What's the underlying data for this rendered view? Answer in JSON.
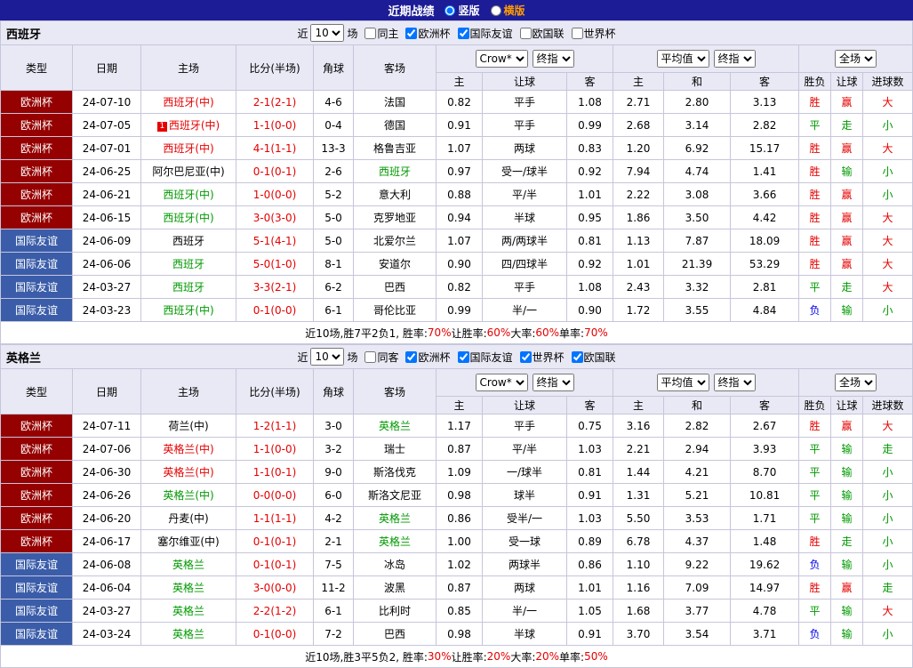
{
  "colors": {
    "topbar_bg": "#1c1c96",
    "header_bg": "#e9e9f5",
    "euro_bg": "#950000",
    "friendly_bg": "#3b5da9",
    "red": "#e60000",
    "green": "#009900",
    "blue": "#0000ee",
    "border": "#c6c6dc",
    "orange": "#ff9c00"
  },
  "topbar": {
    "title": "近期战绩",
    "options": [
      {
        "label": "竖版",
        "selected": true
      },
      {
        "label": "横版",
        "selected": false
      }
    ]
  },
  "columns": {
    "type": "类型",
    "date": "日期",
    "home": "主场",
    "score": "比分(半场)",
    "corner": "角球",
    "away": "客场",
    "sub": [
      "主",
      "让球",
      "客",
      "主",
      "和",
      "客",
      "胜负",
      "让球",
      "进球数"
    ],
    "selects": {
      "book": "Crow*",
      "final1": "终指",
      "avg": "平均值",
      "final2": "终指",
      "scope": "全场"
    }
  },
  "filter_common": {
    "near": "近",
    "games": "场"
  },
  "sections": [
    {
      "team": "西班牙",
      "filter": {
        "count": "10",
        "checks": [
          {
            "label": "同主",
            "checked": false
          },
          {
            "label": "欧洲杯",
            "checked": true
          },
          {
            "label": "国际友谊",
            "checked": true
          },
          {
            "label": "欧国联",
            "checked": false
          },
          {
            "label": "世界杯",
            "checked": false
          }
        ]
      },
      "rows": [
        {
          "type": "欧洲杯",
          "tstyle": "euro",
          "date": "24-07-10",
          "home": "西班牙(中)",
          "hcolor": "red",
          "badge": "",
          "score": "2-1(2-1)",
          "corner": "4-6",
          "away": "法国",
          "acolor": "black",
          "o_home": "0.82",
          "line": "平手",
          "o_away": "1.08",
          "avg_home": "2.71",
          "avg_draw": "2.80",
          "avg_away": "3.13",
          "result": "胜",
          "result_color": "red",
          "cover": "赢",
          "cover_color": "red",
          "ou": "大",
          "ou_color": "red"
        },
        {
          "type": "欧洲杯",
          "tstyle": "euro",
          "date": "24-07-05",
          "home": "西班牙(中)",
          "hcolor": "red",
          "badge": "1",
          "score": "1-1(0-0)",
          "corner": "0-4",
          "away": "德国",
          "acolor": "black",
          "o_home": "0.91",
          "line": "平手",
          "o_away": "0.99",
          "avg_home": "2.68",
          "avg_draw": "3.14",
          "avg_away": "2.82",
          "result": "平",
          "result_color": "green",
          "cover": "走",
          "cover_color": "green",
          "ou": "小",
          "ou_color": "green"
        },
        {
          "type": "欧洲杯",
          "tstyle": "euro",
          "date": "24-07-01",
          "home": "西班牙(中)",
          "hcolor": "red",
          "badge": "",
          "score": "4-1(1-1)",
          "corner": "13-3",
          "away": "格鲁吉亚",
          "acolor": "black",
          "o_home": "1.07",
          "line": "两球",
          "o_away": "0.83",
          "avg_home": "1.20",
          "avg_draw": "6.92",
          "avg_away": "15.17",
          "result": "胜",
          "result_color": "red",
          "cover": "赢",
          "cover_color": "red",
          "ou": "大",
          "ou_color": "red"
        },
        {
          "type": "欧洲杯",
          "tstyle": "euro",
          "date": "24-06-25",
          "home": "阿尔巴尼亚(中)",
          "hcolor": "black",
          "badge": "",
          "score": "0-1(0-1)",
          "corner": "2-6",
          "away": "西班牙",
          "acolor": "green",
          "o_home": "0.97",
          "line": "受一/球半",
          "o_away": "0.92",
          "avg_home": "7.94",
          "avg_draw": "4.74",
          "avg_away": "1.41",
          "result": "胜",
          "result_color": "red",
          "cover": "输",
          "cover_color": "green",
          "ou": "小",
          "ou_color": "green"
        },
        {
          "type": "欧洲杯",
          "tstyle": "euro",
          "date": "24-06-21",
          "home": "西班牙(中)",
          "hcolor": "green",
          "badge": "",
          "score": "1-0(0-0)",
          "corner": "5-2",
          "away": "意大利",
          "acolor": "black",
          "o_home": "0.88",
          "line": "平/半",
          "o_away": "1.01",
          "avg_home": "2.22",
          "avg_draw": "3.08",
          "avg_away": "3.66",
          "result": "胜",
          "result_color": "red",
          "cover": "赢",
          "cover_color": "red",
          "ou": "小",
          "ou_color": "green"
        },
        {
          "type": "欧洲杯",
          "tstyle": "euro",
          "date": "24-06-15",
          "home": "西班牙(中)",
          "hcolor": "green",
          "badge": "",
          "score": "3-0(3-0)",
          "corner": "5-0",
          "away": "克罗地亚",
          "acolor": "black",
          "o_home": "0.94",
          "line": "半球",
          "o_away": "0.95",
          "avg_home": "1.86",
          "avg_draw": "3.50",
          "avg_away": "4.42",
          "result": "胜",
          "result_color": "red",
          "cover": "赢",
          "cover_color": "red",
          "ou": "大",
          "ou_color": "red"
        },
        {
          "type": "国际友谊",
          "tstyle": "friendly",
          "date": "24-06-09",
          "home": "西班牙",
          "hcolor": "black",
          "badge": "",
          "score": "5-1(4-1)",
          "corner": "5-0",
          "away": "北爱尔兰",
          "acolor": "black",
          "o_home": "1.07",
          "line": "两/两球半",
          "o_away": "0.81",
          "avg_home": "1.13",
          "avg_draw": "7.87",
          "avg_away": "18.09",
          "result": "胜",
          "result_color": "red",
          "cover": "赢",
          "cover_color": "red",
          "ou": "大",
          "ou_color": "red"
        },
        {
          "type": "国际友谊",
          "tstyle": "friendly",
          "date": "24-06-06",
          "home": "西班牙",
          "hcolor": "green",
          "badge": "",
          "score": "5-0(1-0)",
          "corner": "8-1",
          "away": "安道尔",
          "acolor": "black",
          "o_home": "0.90",
          "line": "四/四球半",
          "o_away": "0.92",
          "avg_home": "1.01",
          "avg_draw": "21.39",
          "avg_away": "53.29",
          "result": "胜",
          "result_color": "red",
          "cover": "赢",
          "cover_color": "red",
          "ou": "大",
          "ou_color": "red"
        },
        {
          "type": "国际友谊",
          "tstyle": "friendly",
          "date": "24-03-27",
          "home": "西班牙",
          "hcolor": "green",
          "badge": "",
          "score": "3-3(2-1)",
          "corner": "6-2",
          "away": "巴西",
          "acolor": "black",
          "o_home": "0.82",
          "line": "平手",
          "o_away": "1.08",
          "avg_home": "2.43",
          "avg_draw": "3.32",
          "avg_away": "2.81",
          "result": "平",
          "result_color": "green",
          "cover": "走",
          "cover_color": "green",
          "ou": "大",
          "ou_color": "red"
        },
        {
          "type": "国际友谊",
          "tstyle": "friendly",
          "date": "24-03-23",
          "home": "西班牙(中)",
          "hcolor": "green",
          "badge": "",
          "score": "0-1(0-0)",
          "corner": "6-1",
          "away": "哥伦比亚",
          "acolor": "black",
          "o_home": "0.99",
          "line": "半/一",
          "o_away": "0.90",
          "avg_home": "1.72",
          "avg_draw": "3.55",
          "avg_away": "4.84",
          "result": "负",
          "result_color": "blue",
          "cover": "输",
          "cover_color": "green",
          "ou": "小",
          "ou_color": "green"
        }
      ],
      "summary": [
        {
          "t": "近10场,胜7平2负1, 胜率:",
          "r": false
        },
        {
          "t": "70%",
          "r": true
        },
        {
          "t": " 让胜率:",
          "r": false
        },
        {
          "t": "60%",
          "r": true
        },
        {
          "t": " 大率:",
          "r": false
        },
        {
          "t": "60%",
          "r": true
        },
        {
          "t": " 单率:",
          "r": false
        },
        {
          "t": "70%",
          "r": true
        }
      ]
    },
    {
      "team": "英格兰",
      "filter": {
        "count": "10",
        "checks": [
          {
            "label": "同客",
            "checked": false
          },
          {
            "label": "欧洲杯",
            "checked": true
          },
          {
            "label": "国际友谊",
            "checked": true
          },
          {
            "label": "世界杯",
            "checked": true
          },
          {
            "label": "欧国联",
            "checked": true
          }
        ]
      },
      "rows": [
        {
          "type": "欧洲杯",
          "tstyle": "euro",
          "date": "24-07-11",
          "home": "荷兰(中)",
          "hcolor": "black",
          "badge": "",
          "score": "1-2(1-1)",
          "corner": "3-0",
          "away": "英格兰",
          "acolor": "green",
          "o_home": "1.17",
          "line": "平手",
          "o_away": "0.75",
          "avg_home": "3.16",
          "avg_draw": "2.82",
          "avg_away": "2.67",
          "result": "胜",
          "result_color": "red",
          "cover": "赢",
          "cover_color": "red",
          "ou": "大",
          "ou_color": "red"
        },
        {
          "type": "欧洲杯",
          "tstyle": "euro",
          "date": "24-07-06",
          "home": "英格兰(中)",
          "hcolor": "red",
          "badge": "",
          "score": "1-1(0-0)",
          "corner": "3-2",
          "away": "瑞士",
          "acolor": "black",
          "o_home": "0.87",
          "line": "平/半",
          "o_away": "1.03",
          "avg_home": "2.21",
          "avg_draw": "2.94",
          "avg_away": "3.93",
          "result": "平",
          "result_color": "green",
          "cover": "输",
          "cover_color": "green",
          "ou": "走",
          "ou_color": "green"
        },
        {
          "type": "欧洲杯",
          "tstyle": "euro",
          "date": "24-06-30",
          "home": "英格兰(中)",
          "hcolor": "red",
          "badge": "",
          "score": "1-1(0-1)",
          "corner": "9-0",
          "away": "斯洛伐克",
          "acolor": "black",
          "o_home": "1.09",
          "line": "一/球半",
          "o_away": "0.81",
          "avg_home": "1.44",
          "avg_draw": "4.21",
          "avg_away": "8.70",
          "result": "平",
          "result_color": "green",
          "cover": "输",
          "cover_color": "green",
          "ou": "小",
          "ou_color": "green"
        },
        {
          "type": "欧洲杯",
          "tstyle": "euro",
          "date": "24-06-26",
          "home": "英格兰(中)",
          "hcolor": "green",
          "badge": "",
          "score": "0-0(0-0)",
          "corner": "6-0",
          "away": "斯洛文尼亚",
          "acolor": "black",
          "o_home": "0.98",
          "line": "球半",
          "o_away": "0.91",
          "avg_home": "1.31",
          "avg_draw": "5.21",
          "avg_away": "10.81",
          "result": "平",
          "result_color": "green",
          "cover": "输",
          "cover_color": "green",
          "ou": "小",
          "ou_color": "green"
        },
        {
          "type": "欧洲杯",
          "tstyle": "euro",
          "date": "24-06-20",
          "home": "丹麦(中)",
          "hcolor": "black",
          "badge": "",
          "score": "1-1(1-1)",
          "corner": "4-2",
          "away": "英格兰",
          "acolor": "green",
          "o_home": "0.86",
          "line": "受半/一",
          "o_away": "1.03",
          "avg_home": "5.50",
          "avg_draw": "3.53",
          "avg_away": "1.71",
          "result": "平",
          "result_color": "green",
          "cover": "输",
          "cover_color": "green",
          "ou": "小",
          "ou_color": "green"
        },
        {
          "type": "欧洲杯",
          "tstyle": "euro",
          "date": "24-06-17",
          "home": "塞尔维亚(中)",
          "hcolor": "black",
          "badge": "",
          "score": "0-1(0-1)",
          "corner": "2-1",
          "away": "英格兰",
          "acolor": "green",
          "o_home": "1.00",
          "line": "受一球",
          "o_away": "0.89",
          "avg_home": "6.78",
          "avg_draw": "4.37",
          "avg_away": "1.48",
          "result": "胜",
          "result_color": "red",
          "cover": "走",
          "cover_color": "green",
          "ou": "小",
          "ou_color": "green"
        },
        {
          "type": "国际友谊",
          "tstyle": "friendly",
          "date": "24-06-08",
          "home": "英格兰",
          "hcolor": "green",
          "badge": "",
          "score": "0-1(0-1)",
          "corner": "7-5",
          "away": "冰岛",
          "acolor": "black",
          "o_home": "1.02",
          "line": "两球半",
          "o_away": "0.86",
          "avg_home": "1.10",
          "avg_draw": "9.22",
          "avg_away": "19.62",
          "result": "负",
          "result_color": "blue",
          "cover": "输",
          "cover_color": "green",
          "ou": "小",
          "ou_color": "green"
        },
        {
          "type": "国际友谊",
          "tstyle": "friendly",
          "date": "24-06-04",
          "home": "英格兰",
          "hcolor": "green",
          "badge": "",
          "score": "3-0(0-0)",
          "corner": "11-2",
          "away": "波黑",
          "acolor": "black",
          "o_home": "0.87",
          "line": "两球",
          "o_away": "1.01",
          "avg_home": "1.16",
          "avg_draw": "7.09",
          "avg_away": "14.97",
          "result": "胜",
          "result_color": "red",
          "cover": "赢",
          "cover_color": "red",
          "ou": "走",
          "ou_color": "green"
        },
        {
          "type": "国际友谊",
          "tstyle": "friendly",
          "date": "24-03-27",
          "home": "英格兰",
          "hcolor": "green",
          "badge": "",
          "score": "2-2(1-2)",
          "corner": "6-1",
          "away": "比利时",
          "acolor": "black",
          "o_home": "0.85",
          "line": "半/一",
          "o_away": "1.05",
          "avg_home": "1.68",
          "avg_draw": "3.77",
          "avg_away": "4.78",
          "result": "平",
          "result_color": "green",
          "cover": "输",
          "cover_color": "green",
          "ou": "大",
          "ou_color": "red"
        },
        {
          "type": "国际友谊",
          "tstyle": "friendly",
          "date": "24-03-24",
          "home": "英格兰",
          "hcolor": "green",
          "badge": "",
          "score": "0-1(0-0)",
          "corner": "7-2",
          "away": "巴西",
          "acolor": "black",
          "o_home": "0.98",
          "line": "半球",
          "o_away": "0.91",
          "avg_home": "3.70",
          "avg_draw": "3.54",
          "avg_away": "3.71",
          "result": "负",
          "result_color": "blue",
          "cover": "输",
          "cover_color": "green",
          "ou": "小",
          "ou_color": "green"
        }
      ],
      "summary": [
        {
          "t": "近10场,胜3平5负2, 胜率:",
          "r": false
        },
        {
          "t": "30%",
          "r": true
        },
        {
          "t": " 让胜率:",
          "r": false
        },
        {
          "t": "20%",
          "r": true
        },
        {
          "t": " 大率:",
          "r": false
        },
        {
          "t": "20%",
          "r": true
        },
        {
          "t": " 单率:",
          "r": false
        },
        {
          "t": "50%",
          "r": true
        }
      ]
    }
  ]
}
